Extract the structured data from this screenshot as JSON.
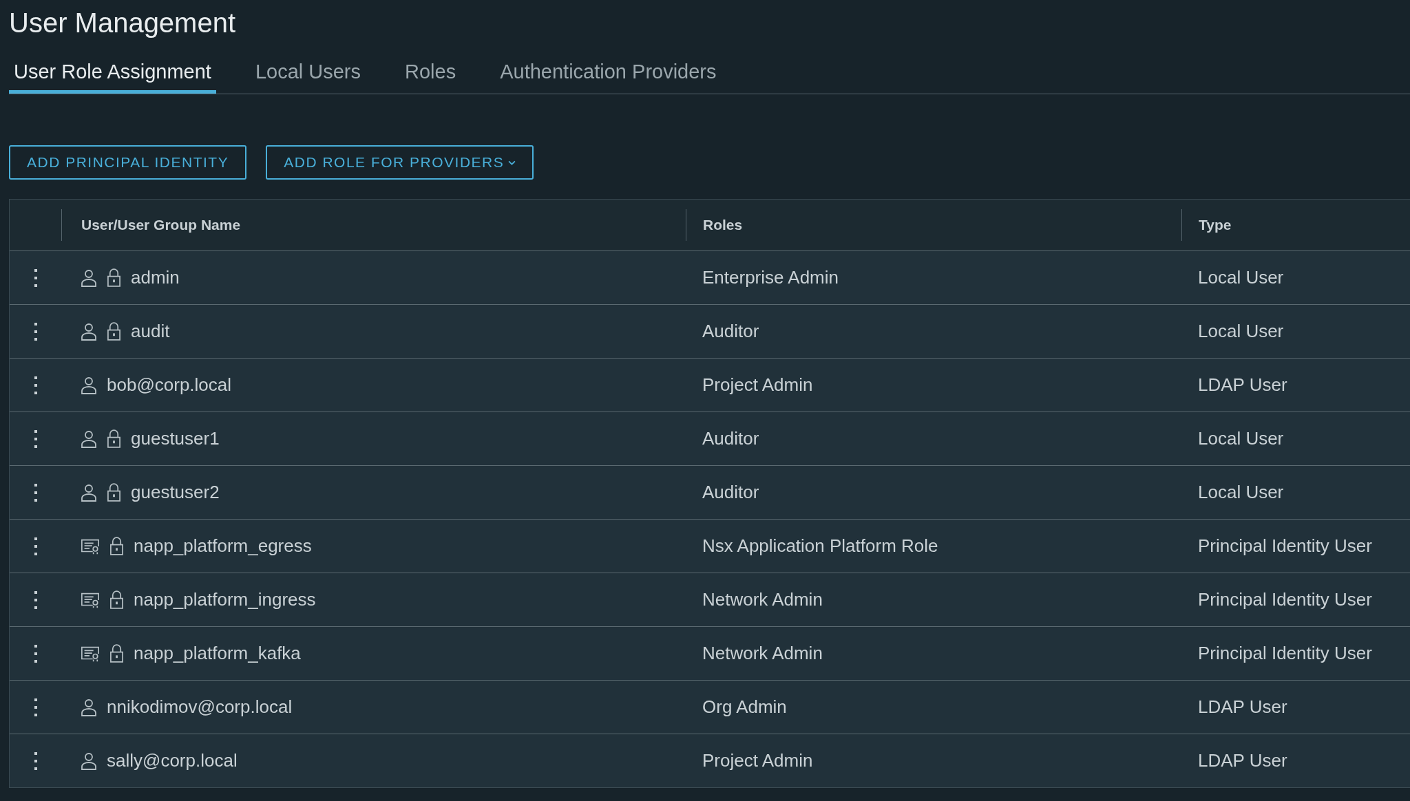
{
  "page": {
    "title": "User Management"
  },
  "tabs": [
    {
      "label": "User Role Assignment",
      "selected": true
    },
    {
      "label": "Local Users",
      "selected": false
    },
    {
      "label": "Roles",
      "selected": false
    },
    {
      "label": "Authentication Providers",
      "selected": false
    }
  ],
  "actions": [
    {
      "label": "ADD PRINCIPAL IDENTITY",
      "dropdown": false
    },
    {
      "label": "ADD ROLE FOR PROVIDERS",
      "dropdown": true
    }
  ],
  "table": {
    "columns": [
      "User/User Group Name",
      "Roles",
      "Type"
    ],
    "rows": [
      {
        "kind": "user",
        "locked": true,
        "name": "admin",
        "role": "Enterprise Admin",
        "type": "Local User"
      },
      {
        "kind": "user",
        "locked": true,
        "name": "audit",
        "role": "Auditor",
        "type": "Local User"
      },
      {
        "kind": "user",
        "locked": false,
        "name": "bob@corp.local",
        "role": "Project Admin",
        "type": "LDAP User"
      },
      {
        "kind": "user",
        "locked": true,
        "name": "guestuser1",
        "role": "Auditor",
        "type": "Local User"
      },
      {
        "kind": "user",
        "locked": true,
        "name": "guestuser2",
        "role": "Auditor",
        "type": "Local User"
      },
      {
        "kind": "certificate",
        "locked": true,
        "name": "napp_platform_egress",
        "role": "Nsx Application Platform Role",
        "type": "Principal Identity User"
      },
      {
        "kind": "certificate",
        "locked": true,
        "name": "napp_platform_ingress",
        "role": "Network Admin",
        "type": "Principal Identity User"
      },
      {
        "kind": "certificate",
        "locked": true,
        "name": "napp_platform_kafka",
        "role": "Network Admin",
        "type": "Principal Identity User"
      },
      {
        "kind": "user",
        "locked": false,
        "name": "nnikodimov@corp.local",
        "role": "Org Admin",
        "type": "LDAP User"
      },
      {
        "kind": "user",
        "locked": false,
        "name": "sally@corp.local",
        "role": "Project Admin",
        "type": "LDAP User"
      }
    ]
  }
}
